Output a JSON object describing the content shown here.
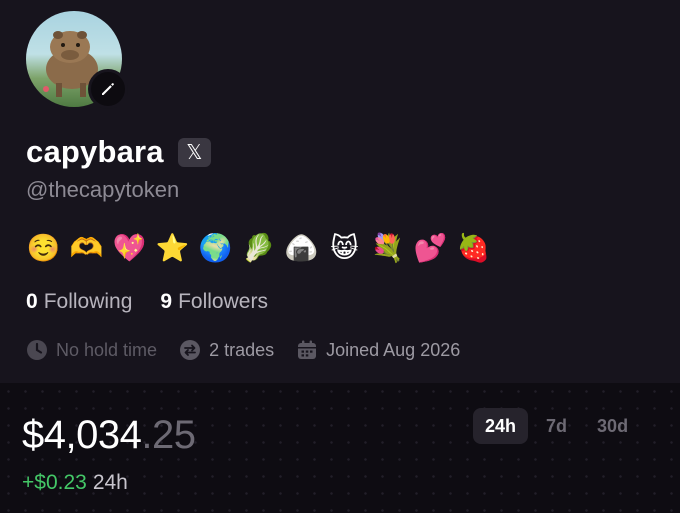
{
  "profile": {
    "display_name": "capybara",
    "x_badge": "𝕏",
    "handle": "@thecapytoken",
    "bio_emojis": [
      "☺️",
      "🫶",
      "💖",
      "⭐",
      "🌍",
      "🥬",
      "🍙",
      "😸",
      "💐",
      "💕",
      "🍓"
    ],
    "following_count": "0",
    "following_label": "Following",
    "followers_count": "9",
    "followers_label": "Followers",
    "hold_time": "No hold time",
    "trades": "2 trades",
    "joined": "Joined Aug 2026"
  },
  "wallet": {
    "balance_dollars": "$4,034",
    "balance_cents": ".25",
    "change_amount": "+$0.23",
    "change_period": "24h",
    "tabs": [
      {
        "label": "24h",
        "active": true
      },
      {
        "label": "7d",
        "active": false
      },
      {
        "label": "30d",
        "active": false
      }
    ]
  },
  "colors": {
    "background": "#17141d",
    "positive": "#44c767",
    "muted": "#6d6a74"
  }
}
